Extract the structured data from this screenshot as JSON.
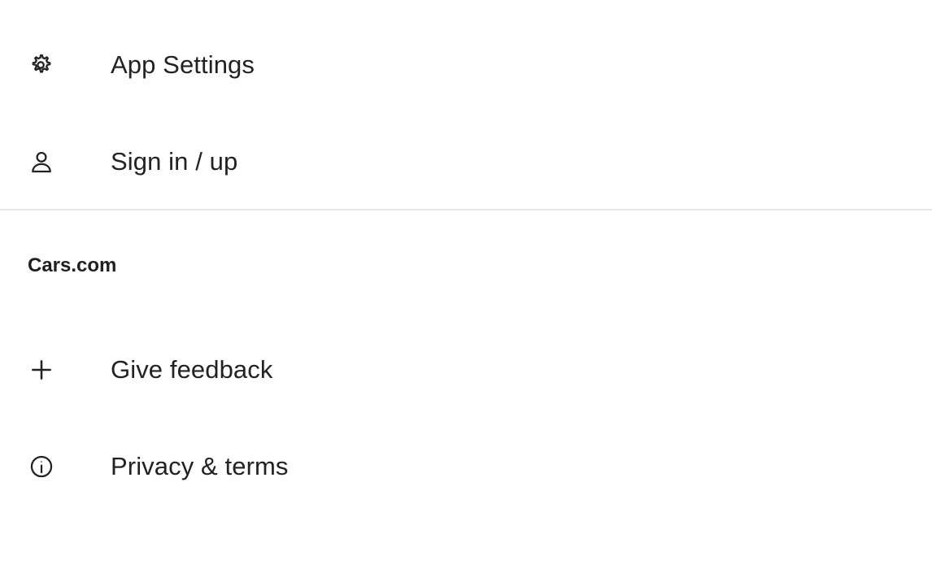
{
  "account_menu": {
    "items": [
      {
        "label": "App Settings",
        "icon": "gear-icon"
      },
      {
        "label": "Sign in / up",
        "icon": "person-icon"
      }
    ]
  },
  "site_section": {
    "title": "Cars.com",
    "items": [
      {
        "label": "Give feedback",
        "icon": "plus-icon"
      },
      {
        "label": "Privacy & terms",
        "icon": "info-icon"
      }
    ]
  },
  "colors": {
    "text": "#222222",
    "divider": "#e7e7e7",
    "background": "#ffffff"
  }
}
